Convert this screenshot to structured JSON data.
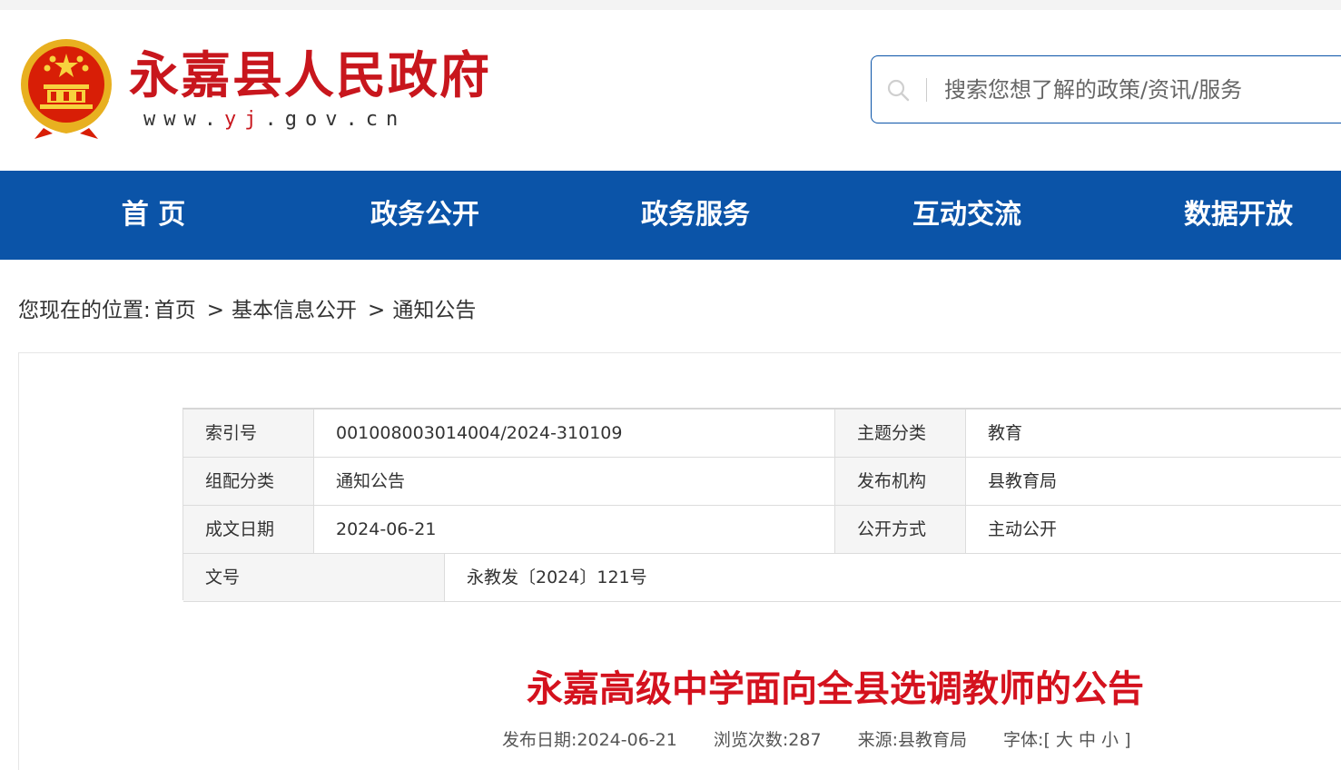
{
  "header": {
    "site_name": "永嘉县人民政府",
    "url_prefix": "www.",
    "url_highlight": "yj",
    "url_suffix": ".gov.cn",
    "search_placeholder": "搜索您想了解的政策/资讯/服务"
  },
  "nav": {
    "items": [
      {
        "label": "首 页"
      },
      {
        "label": "政务公开"
      },
      {
        "label": "政务服务"
      },
      {
        "label": "互动交流"
      },
      {
        "label": "数据开放"
      }
    ]
  },
  "breadcrumb": {
    "prefix": "您现在的位置:",
    "items": [
      "首页",
      "基本信息公开",
      "通知公告"
    ],
    "separator": ">"
  },
  "meta": {
    "index_label": "索引号",
    "index_value": "001008003014004/2024-310109",
    "topic_label": "主题分类",
    "topic_value": "教育",
    "group_label": "组配分类",
    "group_value": "通知公告",
    "publisher_label": "发布机构",
    "publisher_value": "县教育局",
    "date_label": "成文日期",
    "date_value": "2024-06-21",
    "disclosure_label": "公开方式",
    "disclosure_value": "主动公开",
    "docno_label": "文号",
    "docno_value": "永教发〔2024〕121号"
  },
  "article": {
    "title": "永嘉高级中学面向全县选调教师的公告",
    "publish_date": "发布日期:2024-06-21",
    "views": "浏览次数:287",
    "source": "来源:县教育局",
    "font_label": "字体:[",
    "font_large": "大",
    "font_medium": "中",
    "font_small": "小",
    "font_close": "]"
  },
  "colors": {
    "brand_red": "#c8161d",
    "nav_blue": "#0b54a8",
    "title_red": "#d4121e"
  }
}
